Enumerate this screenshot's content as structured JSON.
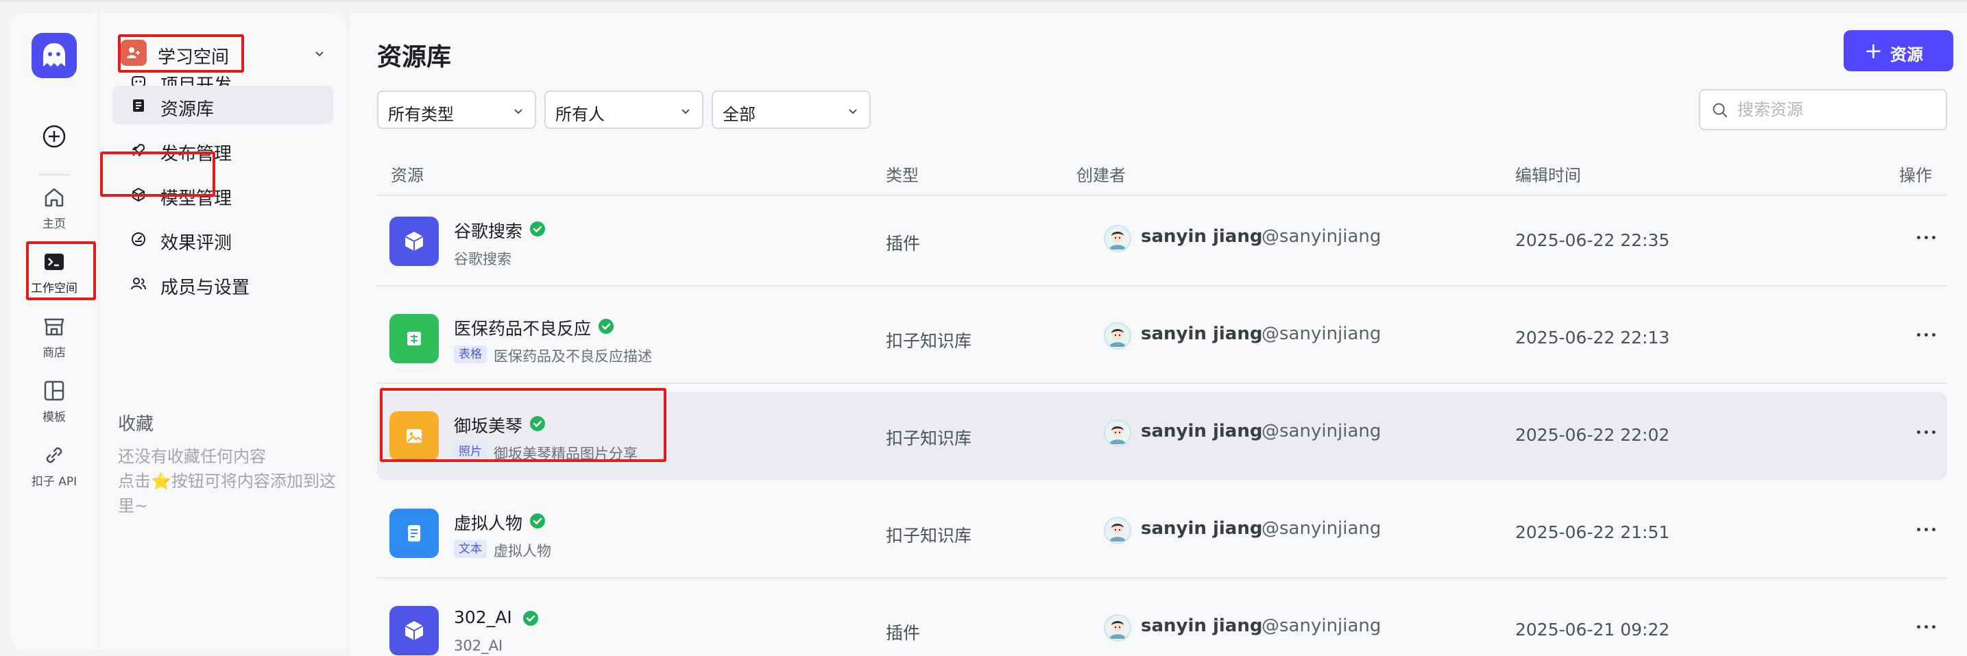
{
  "rail": {
    "items": [
      {
        "label": "主页",
        "icon": "home-icon"
      },
      {
        "label": "工作空间",
        "icon": "workspace-terminal-icon"
      },
      {
        "label": "商店",
        "icon": "store-icon"
      },
      {
        "label": "模板",
        "icon": "template-icon"
      },
      {
        "label": "扣子 API",
        "icon": "api-link-icon"
      }
    ]
  },
  "sidebar": {
    "workspace_name": "学习空间",
    "nav": [
      {
        "label": "项目开发",
        "icon": "project-dev-icon"
      },
      {
        "label": "资源库",
        "icon": "library-icon"
      },
      {
        "label": "发布管理",
        "icon": "rocket-icon"
      },
      {
        "label": "模型管理",
        "icon": "model-cube-icon"
      },
      {
        "label": "效果评测",
        "icon": "gauge-icon"
      },
      {
        "label": "成员与设置",
        "icon": "members-icon"
      }
    ],
    "favorites_title": "收藏",
    "favorites_empty_line1": "还没有收藏任何内容",
    "favorites_empty_line2_pre": "点击",
    "favorites_empty_star": "⭐",
    "favorites_empty_line2_post": "按钮可将内容添加到这里~"
  },
  "main": {
    "title": "资源库",
    "add_button": "资源",
    "filters": [
      "所有类型",
      "所有人",
      "全部"
    ],
    "search_placeholder": "搜索资源",
    "columns": [
      "资源",
      "类型",
      "创建者",
      "编辑时间",
      "操作"
    ],
    "rows": [
      {
        "name": "谷歌搜索",
        "tag": "",
        "desc": "谷歌搜索",
        "type": "插件",
        "creator": "sanyin jiang",
        "handle": "@sanyinjiang",
        "time": "2025-06-22 22:35",
        "icon": "plugin-cube-icon",
        "color": "#4f55e6"
      },
      {
        "name": "医保药品不良反应",
        "tag": "表格",
        "desc": "医保药品及不良反应描述",
        "type": "扣子知识库",
        "creator": "sanyin jiang",
        "handle": "@sanyinjiang",
        "time": "2025-06-22 22:13",
        "icon": "table-icon",
        "color": "#2fbe5c"
      },
      {
        "name": "御坂美琴",
        "tag": "照片",
        "desc": "御坂美琴精品图片分享",
        "type": "扣子知识库",
        "creator": "sanyin jiang",
        "handle": "@sanyinjiang",
        "time": "2025-06-22 22:02",
        "icon": "image-icon",
        "color": "#f7ae2b"
      },
      {
        "name": "虚拟人物",
        "tag": "文本",
        "desc": "虚拟人物",
        "type": "扣子知识库",
        "creator": "sanyin jiang",
        "handle": "@sanyinjiang",
        "time": "2025-06-22 21:51",
        "icon": "document-icon",
        "color": "#2f8cf0"
      },
      {
        "name": "302_AI",
        "tag": "",
        "desc": "302_AI",
        "type": "插件",
        "creator": "sanyin jiang",
        "handle": "@sanyinjiang",
        "time": "2025-06-21 09:22",
        "icon": "plugin-cube-icon",
        "color": "#4f55e6"
      }
    ]
  },
  "colors": {
    "accent": "#5147ff",
    "verified": "#1fb35a",
    "highlight_box": "#e31b1b"
  }
}
